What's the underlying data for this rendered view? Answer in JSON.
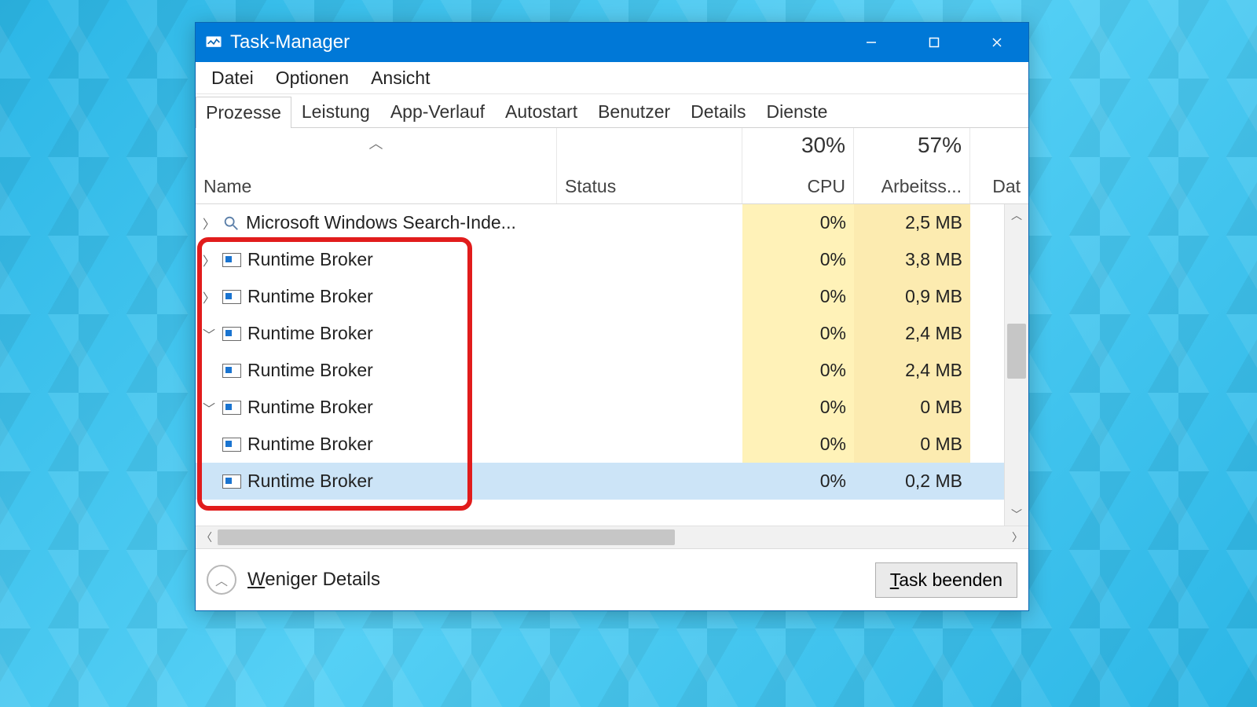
{
  "window": {
    "title": "Task-Manager"
  },
  "menu": {
    "file": "Datei",
    "options": "Optionen",
    "view": "Ansicht"
  },
  "tabs": {
    "processes": "Prozesse",
    "performance": "Leistung",
    "app_history": "App-Verlauf",
    "startup": "Autostart",
    "users": "Benutzer",
    "details": "Details",
    "services": "Dienste"
  },
  "columns": {
    "name": "Name",
    "status": "Status",
    "cpu_pct": "30%",
    "cpu_label": "CPU",
    "mem_pct": "57%",
    "mem_label": "Arbeitss...",
    "disk_label": "Dat"
  },
  "rows": [
    {
      "expand": ">",
      "indent": 1,
      "icon": "search",
      "name": "Microsoft Windows Search-Inde...",
      "cpu": "0%",
      "mem": "2,5 MB",
      "selected": false
    },
    {
      "expand": ">",
      "indent": 1,
      "icon": "generic",
      "name": "Runtime Broker",
      "cpu": "0%",
      "mem": "3,8 MB",
      "selected": false
    },
    {
      "expand": ">",
      "indent": 1,
      "icon": "generic",
      "name": "Runtime Broker",
      "cpu": "0%",
      "mem": "0,9 MB",
      "selected": false
    },
    {
      "expand": "v",
      "indent": 1,
      "icon": "generic",
      "name": "Runtime Broker",
      "cpu": "0%",
      "mem": "2,4 MB",
      "selected": false
    },
    {
      "expand": "",
      "indent": 2,
      "icon": "generic",
      "name": "Runtime Broker",
      "cpu": "0%",
      "mem": "2,4 MB",
      "selected": false
    },
    {
      "expand": "v",
      "indent": 1,
      "icon": "generic",
      "name": "Runtime Broker",
      "cpu": "0%",
      "mem": "0 MB",
      "selected": false
    },
    {
      "expand": "",
      "indent": 2,
      "icon": "generic",
      "name": "Runtime Broker",
      "cpu": "0%",
      "mem": "0 MB",
      "selected": false
    },
    {
      "expand": "",
      "indent": 2,
      "icon": "generic",
      "name": "Runtime Broker",
      "cpu": "0%",
      "mem": "0,2 MB",
      "selected": true
    }
  ],
  "footer": {
    "less_details": "Weniger Details",
    "end_task": "Task beenden"
  }
}
